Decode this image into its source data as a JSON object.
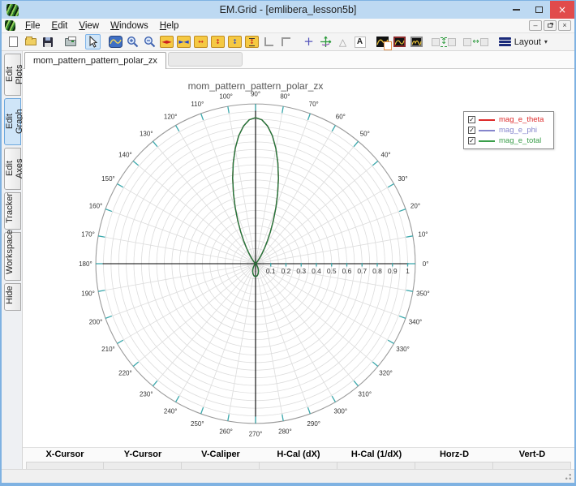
{
  "window": {
    "title": "EM.Grid - [emlibera_lesson5b]",
    "controls": {
      "minimize": "minimize",
      "maximize": "maximize",
      "close": "close"
    }
  },
  "menu": {
    "items": [
      "File",
      "Edit",
      "View",
      "Windows",
      "Help"
    ],
    "mdi_controls": [
      "minimize",
      "restore",
      "close"
    ]
  },
  "toolbar": {
    "buttons": [
      "new-file",
      "open-file",
      "save-file",
      "sep",
      "print",
      "sep",
      "pointer-select",
      "sep",
      "fit-view",
      "zoom-in",
      "zoom-out",
      "expand-x",
      "shrink-x",
      "center-x",
      "expand-y",
      "shrink-y",
      "center-y",
      "corner-lower",
      "corner-upper",
      "sep",
      "add-marker",
      "tracker-axes",
      "triangle-marker",
      "text-annotation",
      "sep",
      "copy-plot",
      "plot-style-dark",
      "plot-style-curves",
      "sep",
      "match-height",
      "sep",
      "match-width",
      "sep",
      "layout-dropdown"
    ],
    "layout_label": "Layout"
  },
  "sidebar": {
    "tabs": [
      {
        "label": "Edit Plots",
        "active": false
      },
      {
        "label": "Edit Graph",
        "active": true
      },
      {
        "label": "Edit Axes",
        "active": false
      },
      {
        "label": "Tracker",
        "active": false
      },
      {
        "label": "Workspace",
        "active": false
      },
      {
        "label": "Hide",
        "active": false
      }
    ]
  },
  "tabs": {
    "active_label": "mom_pattern_pattern_polar_zx"
  },
  "readout": {
    "columns": [
      "X-Cursor",
      "Y-Cursor",
      "V-Caliper",
      "H-Cal (dX)",
      "H-Cal (1/dX)",
      "Horz-D",
      "Vert-D"
    ],
    "values": [
      "",
      "",
      "",
      "",
      "",
      "",
      ""
    ]
  },
  "chart_data": {
    "type": "polar",
    "title": "mom_pattern_pattern_polar_zx",
    "angle_unit": "deg",
    "angle_labels": [
      "0°",
      "10°",
      "20°",
      "30°",
      "40°",
      "50°",
      "60°",
      "70°",
      "80°",
      "90°",
      "100°",
      "110°",
      "120°",
      "130°",
      "140°",
      "150°",
      "160°",
      "170°",
      "180°",
      "190°",
      "200°",
      "210°",
      "220°",
      "230°",
      "240°",
      "250°",
      "260°",
      "270°",
      "280°",
      "290°",
      "300°",
      "310°",
      "320°",
      "330°",
      "340°",
      "350°"
    ],
    "angle_tick_step_deg": 10,
    "radial_ticks": [
      0.1,
      0.2,
      0.3,
      0.4,
      0.5,
      0.6,
      0.7,
      0.8,
      0.9,
      1.0
    ],
    "radial_tick_labels": [
      "0.1",
      "0.2",
      "0.3",
      "0.4",
      "0.5",
      "0.6",
      "0.7",
      "0.8",
      "0.9",
      "1"
    ],
    "r_axis": {
      "min": 0,
      "max": 1.0,
      "grid_circle_step": 0.05,
      "boundary_r": 1.05
    },
    "grid": {
      "on": true,
      "spoke_step_deg": 10,
      "grid_color": "#dcdcdc",
      "boundary_color": "#9a9a9a",
      "tick_color": "#3ba8ac",
      "axis_color": "#000000"
    },
    "legend": {
      "position": "top-right",
      "entries": [
        {
          "label": "mag_e_theta",
          "color": "#dd2a2a",
          "checked": true
        },
        {
          "label": "mag_e_phi",
          "color": "#8585cc",
          "checked": true
        },
        {
          "label": "mag_e_total",
          "color": "#3a9e4a",
          "checked": true
        }
      ]
    },
    "series": [
      {
        "name": "mag_e_theta",
        "color": "#dd2a2a",
        "points_ref": "mag_e_total"
      },
      {
        "name": "mag_e_phi",
        "color": "#8585cc",
        "points_theta_r": [
          [
            0,
            0
          ],
          [
            90,
            0
          ],
          [
            180,
            0
          ],
          [
            270,
            0
          ],
          [
            360,
            0
          ]
        ]
      },
      {
        "name": "mag_e_total",
        "color": "#1e7a3e",
        "points_theta_r": [
          [
            0,
            0
          ],
          [
            10,
            0
          ],
          [
            20,
            0
          ],
          [
            30,
            0.0001
          ],
          [
            35,
            0.0003
          ],
          [
            40,
            0.0016
          ],
          [
            45,
            0.0063
          ],
          [
            47.5,
            0.0116
          ],
          [
            50,
            0.0201
          ],
          [
            52.5,
            0.0335
          ],
          [
            55,
            0.0532
          ],
          [
            57.5,
            0.0812
          ],
          [
            60,
            0.1193
          ],
          [
            62.5,
            0.1688
          ],
          [
            65,
            0.2305
          ],
          [
            67.5,
            0.3045
          ],
          [
            70,
            0.39
          ],
          [
            72.5,
            0.483
          ],
          [
            75,
            0.581
          ],
          [
            77.5,
            0.678
          ],
          [
            80,
            0.769
          ],
          [
            82.5,
            0.848
          ],
          [
            85,
            0.908
          ],
          [
            87.5,
            0.947
          ],
          [
            90,
            0.96
          ],
          [
            92.5,
            0.947
          ],
          [
            95,
            0.908
          ],
          [
            97.5,
            0.848
          ],
          [
            100,
            0.769
          ],
          [
            102.5,
            0.678
          ],
          [
            105,
            0.581
          ],
          [
            107.5,
            0.483
          ],
          [
            110,
            0.39
          ],
          [
            112.5,
            0.3045
          ],
          [
            115,
            0.2305
          ],
          [
            117.5,
            0.1688
          ],
          [
            120,
            0.1193
          ],
          [
            122.5,
            0.0812
          ],
          [
            125,
            0.0532
          ],
          [
            127.5,
            0.0335
          ],
          [
            130,
            0.0201
          ],
          [
            132.5,
            0.0116
          ],
          [
            135,
            0.0063
          ],
          [
            140,
            0.0016
          ],
          [
            145,
            0.0003
          ],
          [
            150,
            0.0001
          ],
          [
            160,
            0
          ],
          [
            170,
            0
          ],
          [
            180,
            0
          ],
          [
            190,
            0
          ],
          [
            200,
            0
          ],
          [
            210,
            0.0007
          ],
          [
            220,
            0.0039
          ],
          [
            230,
            0.0131
          ],
          [
            240,
            0.0311
          ],
          [
            245,
            0.0427
          ],
          [
            250,
            0.055
          ],
          [
            255,
            0.0667
          ],
          [
            260,
            0.0764
          ],
          [
            265,
            0.0828
          ],
          [
            270,
            0.085
          ],
          [
            275,
            0.0828
          ],
          [
            280,
            0.0764
          ],
          [
            285,
            0.0667
          ],
          [
            290,
            0.055
          ],
          [
            295,
            0.0427
          ],
          [
            300,
            0.0311
          ],
          [
            310,
            0.0131
          ],
          [
            320,
            0.0039
          ],
          [
            330,
            0.0007
          ],
          [
            340,
            0
          ],
          [
            350,
            0
          ],
          [
            360,
            0
          ]
        ]
      }
    ]
  }
}
